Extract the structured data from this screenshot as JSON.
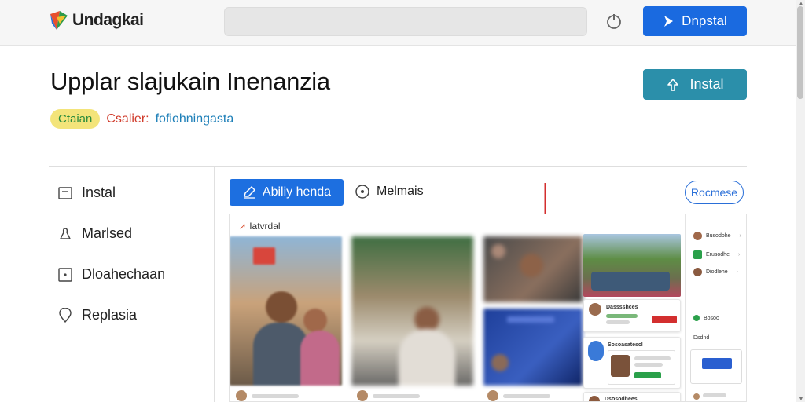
{
  "app": {
    "logo_text": "Undagkai",
    "search_placeholder": "",
    "top_install_label": "Dnpstal"
  },
  "page": {
    "title": "Upplar slajukain Inenanzia",
    "install_label": "Instal",
    "meta": {
      "badge": "Ctaian",
      "red_text": "Csalier:",
      "blue_text": "fofiohningasta"
    }
  },
  "sidebar": {
    "items": [
      {
        "label": "Instal",
        "icon": "square-minus-icon"
      },
      {
        "label": "Marlsed",
        "icon": "person-icon"
      },
      {
        "label": "Dloahechaan",
        "icon": "square-dot-icon"
      },
      {
        "label": "Replasia",
        "icon": "pin-icon"
      }
    ]
  },
  "toolbar": {
    "apply_label": "Abiliy henda",
    "details_label": "Melmais",
    "outline_label": "Rocmese"
  },
  "gallery": {
    "header": "Iatvrdal",
    "cards": [
      {
        "title": "Dasssshces",
        "button": ""
      },
      {
        "title": "Sosoasatescl"
      },
      {
        "title": "Dsosodhees"
      }
    ]
  },
  "right_panel": {
    "items": [
      "Busodohe",
      "Erusodhe",
      "Diodlehe"
    ],
    "status": "Bosoo",
    "section": "Dsdnd"
  },
  "colors": {
    "primary": "#1a6ae0",
    "teal": "#2b8faa",
    "badge_bg": "#f3e47a",
    "red": "#d03a2a"
  }
}
